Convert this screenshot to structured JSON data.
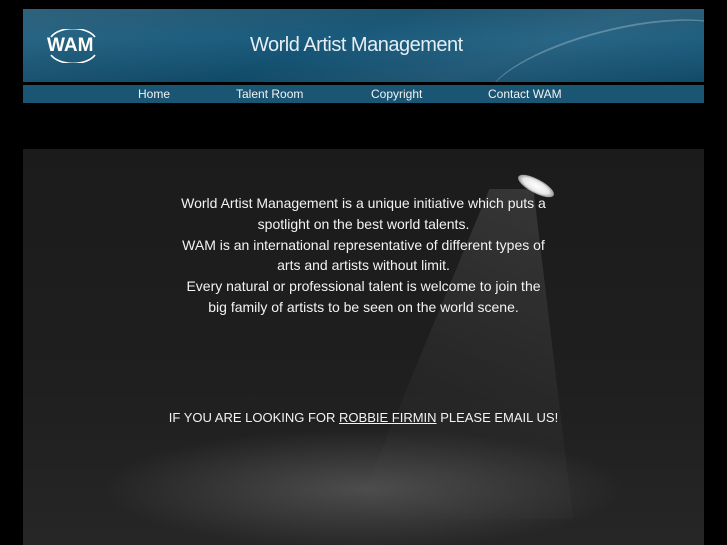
{
  "header": {
    "logo_text": "WAM",
    "title": "World Artist Management",
    "colors": {
      "banner": "#195a7c",
      "nav": "#1a5673",
      "background": "#000000"
    }
  },
  "nav": {
    "items": [
      {
        "label": "Home"
      },
      {
        "label": "Talent Room"
      },
      {
        "label": "Copyright"
      },
      {
        "label": "Contact WAM"
      }
    ]
  },
  "intro": {
    "lines": [
      "World Artist Management is a unique initiative which puts a",
      "spotlight on the best world talents.",
      "WAM is an international representative of different types of",
      "arts and artists without limit.",
      "Every natural or professional talent is welcome to join the",
      "big family of artists to be seen on the world scene."
    ]
  },
  "cta": {
    "prefix": "IF YOU ARE LOOKING FOR",
    "link": "ROBBIE FIRMIN",
    "suffix": "PLEASE EMAIL US!"
  }
}
